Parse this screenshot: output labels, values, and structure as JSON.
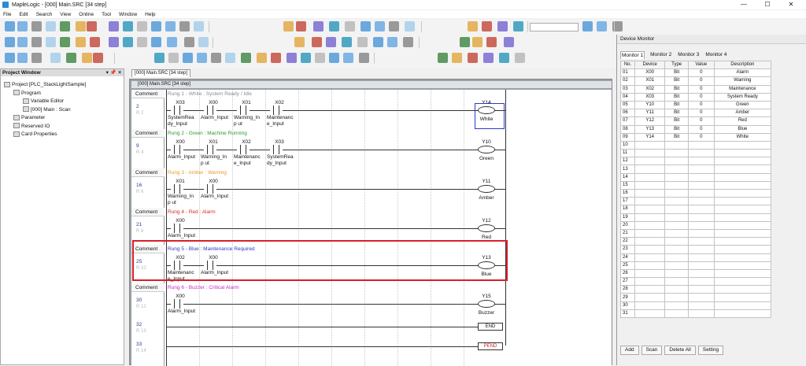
{
  "window": {
    "title": "MapleLogic - [000] Main.SRC [34 step]",
    "minimize": "—",
    "maximize": "☐",
    "close": "✕"
  },
  "menu": [
    "File",
    "Edit",
    "Search",
    "View",
    "Online",
    "Tool",
    "Window",
    "Help"
  ],
  "project_window": {
    "title": "Project Window",
    "tree": [
      {
        "label": "Project [PLC_StackLightSample]",
        "indent": 0,
        "icon": "project-icon"
      },
      {
        "label": "Program",
        "indent": 1,
        "icon": "folder-icon"
      },
      {
        "label": "Variable Editor",
        "indent": 2,
        "icon": "variable-editor-icon"
      },
      {
        "label": "[000] Main : Scan",
        "indent": 2,
        "icon": "scan-program-icon"
      },
      {
        "label": "Parameter",
        "indent": 1,
        "icon": "folder-icon"
      },
      {
        "label": "Reserved IO",
        "indent": 1,
        "icon": "folder-icon"
      },
      {
        "label": "Card Properties",
        "indent": 1,
        "icon": "card-icon"
      }
    ]
  },
  "doc_tab": "[000] Main.SRC [34 step]",
  "editor_title": "[000] Main.SRC [34 step]",
  "ladder": {
    "comment_label": "Comment",
    "rungs": [
      {
        "comment": "Rung 1 - White : System Ready / Idle",
        "comment_color": "#8c8c8c",
        "step": "2",
        "rno": "R 2",
        "contacts": [
          {
            "addr": "X03",
            "name": "SystemRea dy_Input"
          },
          {
            "addr": "X00",
            "name": "Alarm_Input"
          },
          {
            "addr": "X01",
            "name": "Warning_Inp ut"
          },
          {
            "addr": "X02",
            "name": "Maintenanc e_Input"
          }
        ],
        "coil": {
          "addr": "Y14",
          "name": "White"
        }
      },
      {
        "comment": "Rung 2 - Green : Machine Running",
        "comment_color": "#2e9b2e",
        "step": "9",
        "rno": "R 4",
        "contacts": [
          {
            "addr": "X00",
            "name": "Alarm_Input"
          },
          {
            "addr": "X01",
            "name": "Warning_Inp ut"
          },
          {
            "addr": "X02",
            "name": "Maintenanc e_Input"
          },
          {
            "addr": "X03",
            "name": "SystemRea dy_Input"
          }
        ],
        "coil": {
          "addr": "Y10",
          "name": "Green"
        }
      },
      {
        "comment": "Rung 3 - Amber : Warning",
        "comment_color": "#e89b2b",
        "step": "16",
        "rno": "R 6",
        "contacts": [
          {
            "addr": "X01",
            "name": "Warning_Inp ut"
          },
          {
            "addr": "X00",
            "name": "Alarm_Input"
          }
        ],
        "coil": {
          "addr": "Y11",
          "name": "Amber"
        }
      },
      {
        "comment": "Rung 4 - Red : Alarm",
        "comment_color": "#d62a2a",
        "step": "21",
        "rno": "R 8",
        "contacts": [
          {
            "addr": "X00",
            "name": "Alarm_Input"
          }
        ],
        "coil": {
          "addr": "Y12",
          "name": "Red"
        }
      },
      {
        "comment": "Rung 5 - Blue : Maintenance Required",
        "comment_color": "#2b3ac4",
        "step": "25",
        "rno": "R 10",
        "contacts": [
          {
            "addr": "X02",
            "name": "Maintenanc e_Input"
          },
          {
            "addr": "X00",
            "name": "Alarm_Input"
          }
        ],
        "coil": {
          "addr": "Y13",
          "name": "Blue"
        }
      },
      {
        "comment": "Rung 6 - Buzzer : Critical Alarm",
        "comment_color": "#c42bc4",
        "step": "30",
        "rno": "R 12",
        "contacts": [
          {
            "addr": "X00",
            "name": "Alarm_Input"
          }
        ],
        "coil": {
          "addr": "Y15",
          "name": "Buzzer"
        }
      }
    ],
    "end": {
      "step": "32",
      "rno": "R 13",
      "label": "END"
    },
    "pend": {
      "step": "33",
      "rno": "R 14",
      "label": "PEND"
    }
  },
  "device_monitor": {
    "title": "Device Monitor",
    "tabs": [
      "Monitor 1",
      "Monitor 2",
      "Monitor 3",
      "Monitor 4"
    ],
    "columns": [
      "No.",
      "Device",
      "Type",
      "Value",
      "Description"
    ],
    "rows": [
      [
        "01",
        "X00",
        "Bit",
        "0",
        "Alarm"
      ],
      [
        "02",
        "X01",
        "Bit",
        "0",
        "Warning"
      ],
      [
        "03",
        "X02",
        "Bit",
        "0",
        "Maintenance"
      ],
      [
        "04",
        "X03",
        "Bit",
        "0",
        "System Ready"
      ],
      [
        "05",
        "Y10",
        "Bit",
        "0",
        "Green"
      ],
      [
        "06",
        "Y11",
        "Bit",
        "0",
        "Amber"
      ],
      [
        "07",
        "Y12",
        "Bit",
        "0",
        "Red"
      ],
      [
        "08",
        "Y13",
        "Bit",
        "0",
        "Blue"
      ],
      [
        "09",
        "Y14",
        "Bit",
        "0",
        "White"
      ],
      [
        "10",
        "",
        "",
        "",
        ""
      ],
      [
        "11",
        "",
        "",
        "",
        ""
      ],
      [
        "12",
        "",
        "",
        "",
        ""
      ],
      [
        "13",
        "",
        "",
        "",
        ""
      ],
      [
        "14",
        "",
        "",
        "",
        ""
      ],
      [
        "15",
        "",
        "",
        "",
        ""
      ],
      [
        "16",
        "",
        "",
        "",
        ""
      ],
      [
        "17",
        "",
        "",
        "",
        ""
      ],
      [
        "18",
        "",
        "",
        "",
        ""
      ],
      [
        "19",
        "",
        "",
        "",
        ""
      ],
      [
        "20",
        "",
        "",
        "",
        ""
      ],
      [
        "21",
        "",
        "",
        "",
        ""
      ],
      [
        "22",
        "",
        "",
        "",
        ""
      ],
      [
        "23",
        "",
        "",
        "",
        ""
      ],
      [
        "24",
        "",
        "",
        "",
        ""
      ],
      [
        "25",
        "",
        "",
        "",
        ""
      ],
      [
        "26",
        "",
        "",
        "",
        ""
      ],
      [
        "27",
        "",
        "",
        "",
        ""
      ],
      [
        "28",
        "",
        "",
        "",
        ""
      ],
      [
        "29",
        "",
        "",
        "",
        ""
      ],
      [
        "30",
        "",
        "",
        "",
        ""
      ],
      [
        "31",
        "",
        "",
        "",
        ""
      ]
    ],
    "buttons": [
      "Add",
      "Scan",
      "Delete All",
      "Setting"
    ]
  },
  "colors": {
    "highlight": "#d6202a",
    "step": "#2b3a9e"
  }
}
